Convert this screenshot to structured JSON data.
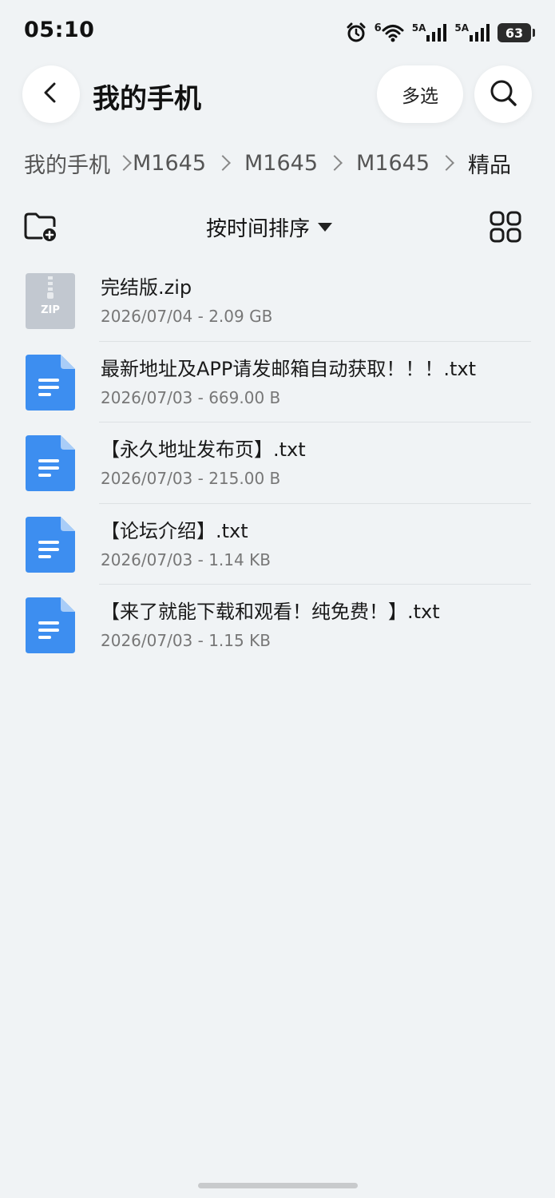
{
  "status_bar": {
    "time": "05:10",
    "wifi_label": "6",
    "sim1_label": "5A",
    "sim2_label": "5A",
    "battery": "63",
    "icons": [
      "alarm-icon",
      "wifi-icon",
      "signal-icon",
      "signal-icon",
      "battery-icon"
    ]
  },
  "header": {
    "title": "我的手机",
    "multi_select_label": "多选",
    "back_icon": "chevron-left-icon",
    "search_icon": "search-icon"
  },
  "breadcrumb": {
    "items": [
      "我的手机",
      "M1645",
      "M1645",
      "M1645",
      "精品"
    ]
  },
  "toolbar": {
    "sort_label": "按时间排序",
    "new_folder_icon": "new-folder-icon",
    "grid_icon": "grid-view-icon"
  },
  "files": [
    {
      "name": "完结版.zip",
      "meta": "2026/07/04 - 2.09 GB",
      "type": "zip",
      "badge": "ZIP"
    },
    {
      "name": "最新地址及APP请发邮箱自动获取！！！.txt",
      "meta": "2026/07/03 - 669.00 B",
      "type": "txt"
    },
    {
      "name": "【永久地址发布页】.txt",
      "meta": "2026/07/03 - 215.00 B",
      "type": "txt"
    },
    {
      "name": "【论坛介绍】.txt",
      "meta": "2026/07/03 - 1.14 KB",
      "type": "txt"
    },
    {
      "name": "【来了就能下载和观看！纯免费！】.txt",
      "meta": "2026/07/03 - 1.15 KB",
      "type": "txt"
    }
  ],
  "colors": {
    "background": "#f0f3f5",
    "doc_icon": "#3d8ef0",
    "zip_icon": "#c2c8d0"
  }
}
